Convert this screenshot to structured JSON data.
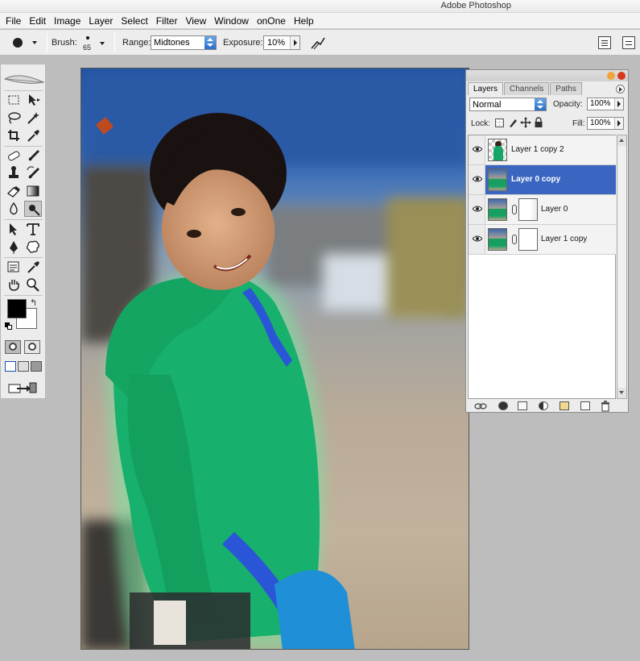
{
  "window": {
    "title": "Adobe Photoshop"
  },
  "menu": {
    "items": [
      "File",
      "Edit",
      "Image",
      "Layer",
      "Select",
      "Filter",
      "View",
      "Window",
      "onOne",
      "Help"
    ]
  },
  "options": {
    "brush_label": "Brush:",
    "brush_size": "65",
    "range_label": "Range:",
    "range_value": "Midtones",
    "exposure_label": "Exposure:",
    "exposure_value": "10%"
  },
  "palette": {
    "tabs": [
      "Layers",
      "Channels",
      "Paths"
    ],
    "active_tab": "Layers",
    "blend_mode": "Normal",
    "opacity_label": "Opacity:",
    "opacity_value": "100%",
    "lock_label": "Lock:",
    "fill_label": "Fill:",
    "fill_value": "100%",
    "layers": [
      {
        "name": "Layer 1 copy 2",
        "selected": false
      },
      {
        "name": "Layer 0 copy",
        "selected": true
      },
      {
        "name": "Layer 0",
        "selected": false
      },
      {
        "name": "Layer 1 copy",
        "selected": false
      }
    ]
  },
  "colors": {
    "foreground": "#000000",
    "background": "#ffffff",
    "selection": "#3a66c2"
  },
  "icons": {
    "toolbox": [
      "marquee-icon",
      "move-icon",
      "lasso-icon",
      "magic-wand-icon",
      "crop-icon",
      "eyedropper-slice-icon",
      "healing-icon",
      "brush-icon",
      "stamp-icon",
      "history-brush-icon",
      "eraser-icon",
      "gradient-icon",
      "blur-icon",
      "dodge-burn-icon",
      "path-select-icon",
      "type-icon",
      "pen-icon",
      "shape-icon",
      "notes-icon",
      "eyedropper-icon",
      "hand-icon",
      "zoom-icon"
    ]
  }
}
